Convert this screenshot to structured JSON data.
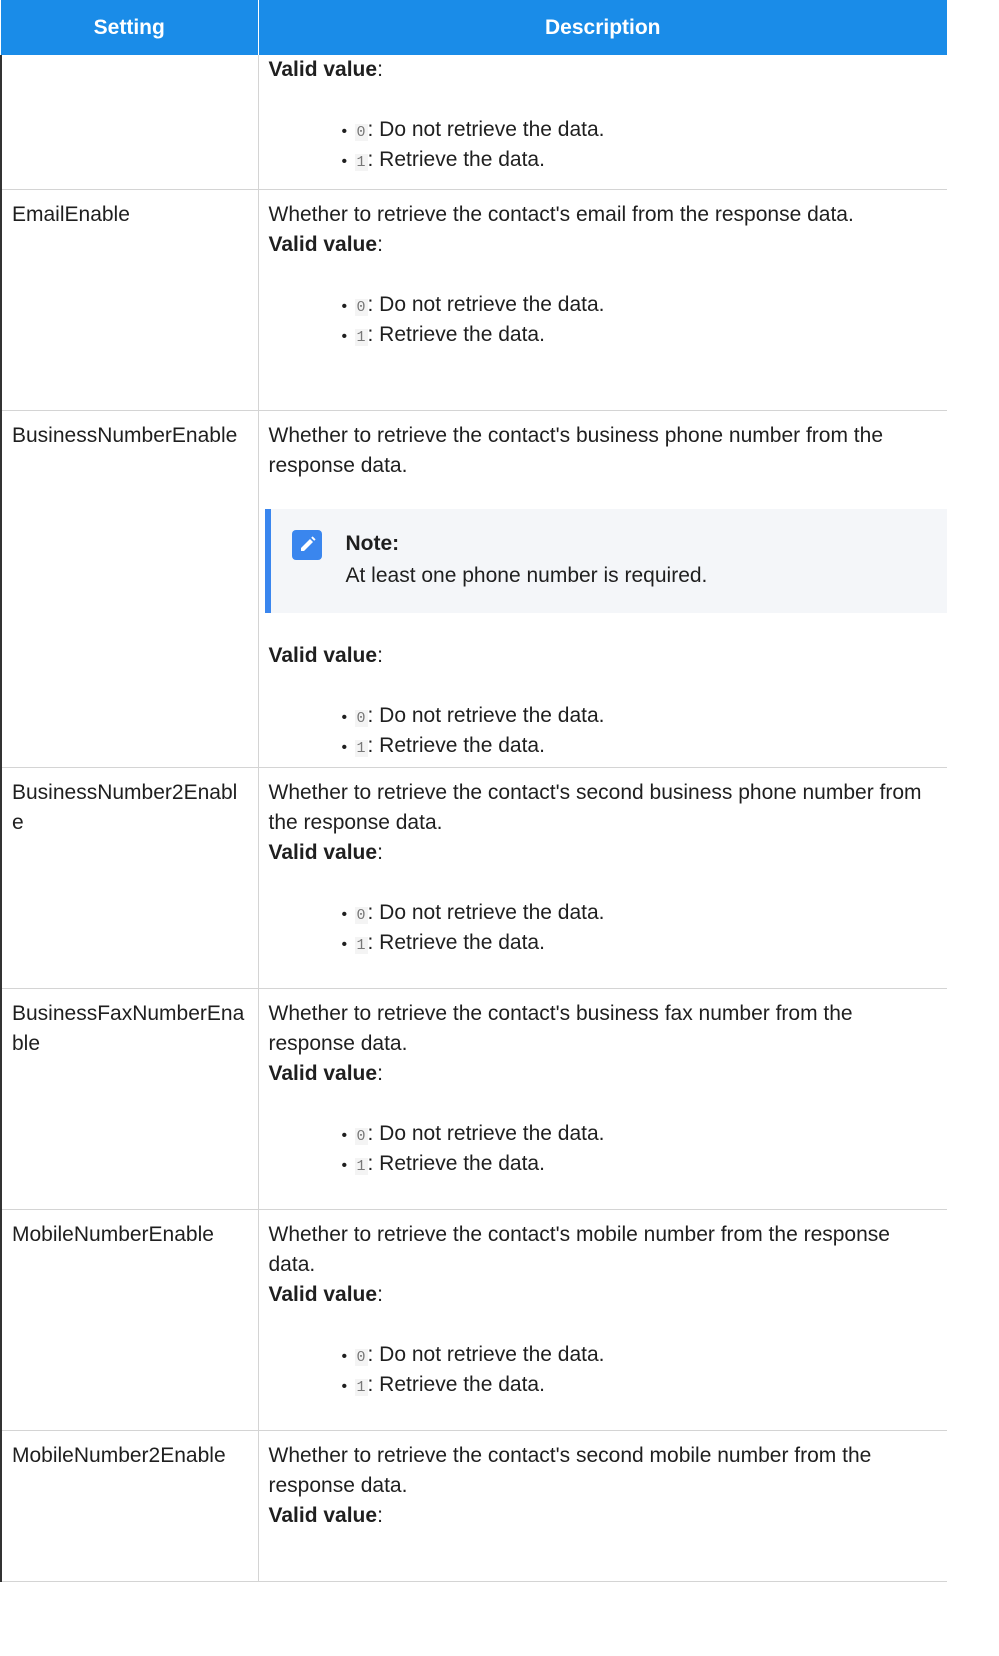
{
  "header": {
    "setting": "Setting",
    "description": "Description"
  },
  "valid_label": "Valid value",
  "valid_colon": ":",
  "values": [
    {
      "code": "0",
      "text": ": Do not retrieve the data."
    },
    {
      "code": "1",
      "text": ": Retrieve the data."
    }
  ],
  "note": {
    "title": "Note:",
    "body": "At least one phone number is required."
  },
  "rows": [
    {
      "setting": "",
      "description": ""
    },
    {
      "setting": "EmailEnable",
      "description": "Whether to retrieve the contact's email from the response data."
    },
    {
      "setting": "BusinessNumberEnable",
      "description": "Whether to retrieve the contact's business phone number from the response data."
    },
    {
      "setting": "BusinessNumber2Enable",
      "description": "Whether to retrieve the contact's second business phone number from the response data."
    },
    {
      "setting": "BusinessFaxNumberEnable",
      "description": "Whether to retrieve the contact's business fax number from the response data."
    },
    {
      "setting": "MobileNumberEnable",
      "description": "Whether to retrieve the contact's mobile number from the response data."
    },
    {
      "setting": "MobileNumber2Enable",
      "description": "Whether to retrieve the contact's second mobile number from the response data."
    }
  ],
  "colors": {
    "header_bg": "#1a8ce8",
    "note_accent": "#3a86ee",
    "note_bg": "#f4f6f9"
  }
}
